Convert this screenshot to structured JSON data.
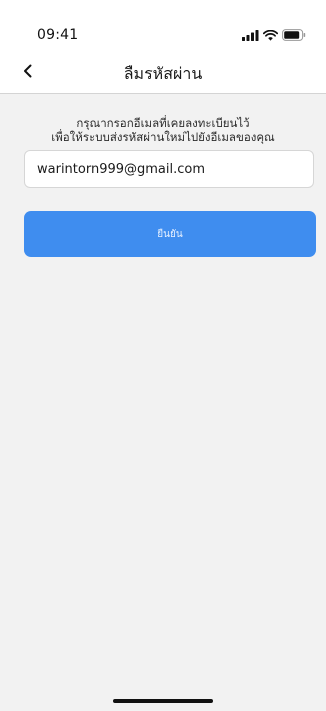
{
  "status_bar": {
    "time": "09:41"
  },
  "nav": {
    "back_icon": "chevron-left-icon",
    "title": "ลืมรหัสผ่าน"
  },
  "instruction": {
    "line1": "กรุณากรอกอีเมลที่เคยลงทะเบียนไว้",
    "line2": "เพื่อให้ระบบส่งรหัสผ่านใหม่ไปยังอีเมลของคุณ"
  },
  "email_field": {
    "value": "warintorn999@gmail.com"
  },
  "confirm_button": {
    "label": "ยืนยัน"
  },
  "colors": {
    "accent": "#3f8def",
    "background": "#f2f2f2"
  }
}
